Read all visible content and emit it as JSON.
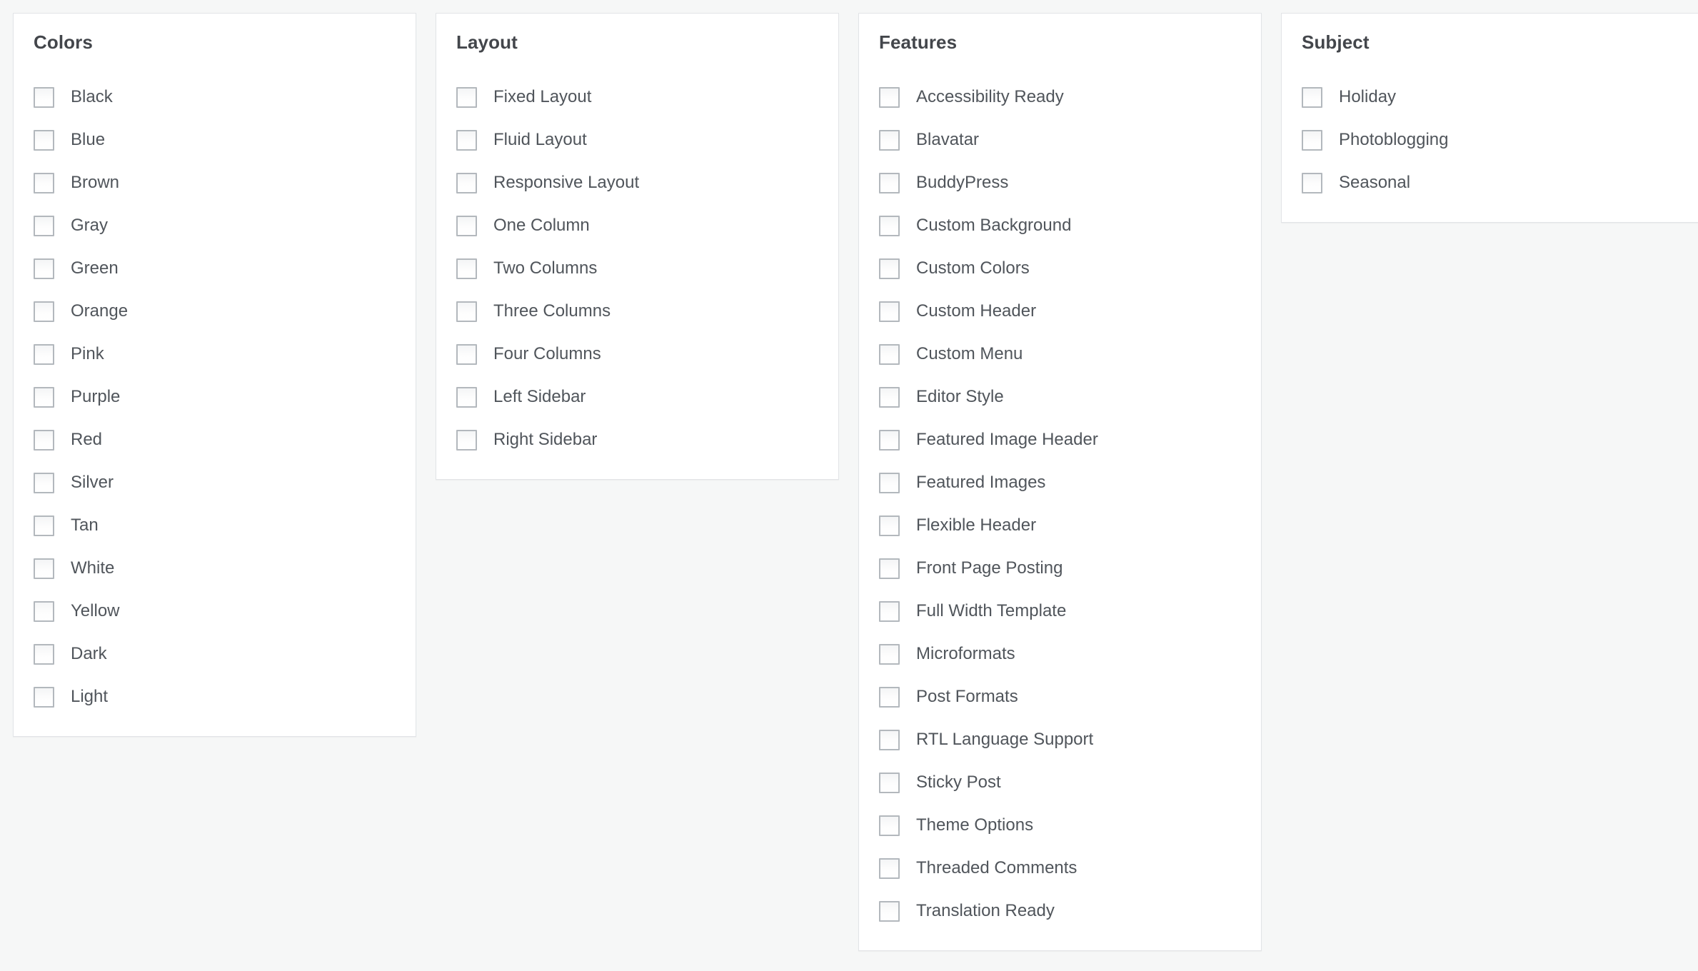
{
  "theme": {
    "page_background": "#f6f7f7",
    "panel_background": "#ffffff",
    "panel_border": "#e2e4e7",
    "heading_color": "#43464b",
    "label_color": "#50555b",
    "checkbox_border": "#b3b8bd"
  },
  "groups": [
    {
      "title": "Colors",
      "items": [
        {
          "label": "Black",
          "checked": false
        },
        {
          "label": "Blue",
          "checked": false
        },
        {
          "label": "Brown",
          "checked": false
        },
        {
          "label": "Gray",
          "checked": false
        },
        {
          "label": "Green",
          "checked": false
        },
        {
          "label": "Orange",
          "checked": false
        },
        {
          "label": "Pink",
          "checked": false
        },
        {
          "label": "Purple",
          "checked": false
        },
        {
          "label": "Red",
          "checked": false
        },
        {
          "label": "Silver",
          "checked": false
        },
        {
          "label": "Tan",
          "checked": false
        },
        {
          "label": "White",
          "checked": false
        },
        {
          "label": "Yellow",
          "checked": false
        },
        {
          "label": "Dark",
          "checked": false
        },
        {
          "label": "Light",
          "checked": false
        }
      ]
    },
    {
      "title": "Layout",
      "items": [
        {
          "label": "Fixed Layout",
          "checked": false
        },
        {
          "label": "Fluid Layout",
          "checked": false
        },
        {
          "label": "Responsive Layout",
          "checked": false
        },
        {
          "label": "One Column",
          "checked": false
        },
        {
          "label": "Two Columns",
          "checked": false
        },
        {
          "label": "Three Columns",
          "checked": false
        },
        {
          "label": "Four Columns",
          "checked": false
        },
        {
          "label": "Left Sidebar",
          "checked": false
        },
        {
          "label": "Right Sidebar",
          "checked": false
        }
      ]
    },
    {
      "title": "Features",
      "items": [
        {
          "label": "Accessibility Ready",
          "checked": false
        },
        {
          "label": "Blavatar",
          "checked": false
        },
        {
          "label": "BuddyPress",
          "checked": false
        },
        {
          "label": "Custom Background",
          "checked": false
        },
        {
          "label": "Custom Colors",
          "checked": false
        },
        {
          "label": "Custom Header",
          "checked": false
        },
        {
          "label": "Custom Menu",
          "checked": false
        },
        {
          "label": "Editor Style",
          "checked": false
        },
        {
          "label": "Featured Image Header",
          "checked": false
        },
        {
          "label": "Featured Images",
          "checked": false
        },
        {
          "label": "Flexible Header",
          "checked": false
        },
        {
          "label": "Front Page Posting",
          "checked": false
        },
        {
          "label": "Full Width Template",
          "checked": false
        },
        {
          "label": "Microformats",
          "checked": false
        },
        {
          "label": "Post Formats",
          "checked": false
        },
        {
          "label": "RTL Language Support",
          "checked": false
        },
        {
          "label": "Sticky Post",
          "checked": false
        },
        {
          "label": "Theme Options",
          "checked": false
        },
        {
          "label": "Threaded Comments",
          "checked": false
        },
        {
          "label": "Translation Ready",
          "checked": false
        }
      ]
    },
    {
      "title": "Subject",
      "items": [
        {
          "label": "Holiday",
          "checked": false
        },
        {
          "label": "Photoblogging",
          "checked": false
        },
        {
          "label": "Seasonal",
          "checked": false
        }
      ]
    }
  ]
}
